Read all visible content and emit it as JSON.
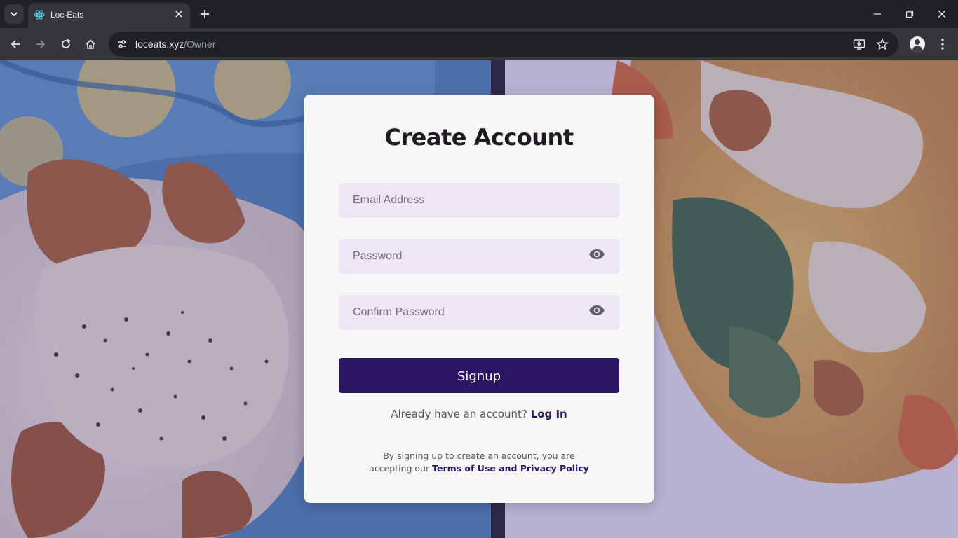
{
  "browser": {
    "tab_title": "Loc-Eats",
    "url_host": "loceats.xyz",
    "url_path": "/Owner"
  },
  "page": {
    "heading": "Create Account",
    "email_placeholder": "Email Address",
    "password_placeholder": "Password",
    "confirm_placeholder": "Confirm Password",
    "signup_label": "Signup",
    "have_account_text": "Already have an account?",
    "login_link": "Log In",
    "terms_line1": "By signing up to create an account, you are",
    "terms_line2_prefix": "accepting our",
    "terms_link": "Terms of Use and Privacy Policy"
  },
  "colors": {
    "accent": "#2b1665",
    "input_bg": "#ede6f5",
    "card_bg": "#f8f7f8",
    "overlay": "#523c96"
  },
  "icons": {
    "tab_search": "chevron-down-icon",
    "favicon": "react-icon",
    "tab_close": "close-icon",
    "new_tab": "plus-icon",
    "back": "arrow-left-icon",
    "forward": "arrow-right-icon",
    "reload": "reload-icon",
    "home": "home-icon",
    "site_info": "tune-icon",
    "install": "install-icon",
    "bookmark": "star-icon",
    "profile": "avatar",
    "menu": "more-vert-icon",
    "password_toggle": "eye-icon"
  }
}
